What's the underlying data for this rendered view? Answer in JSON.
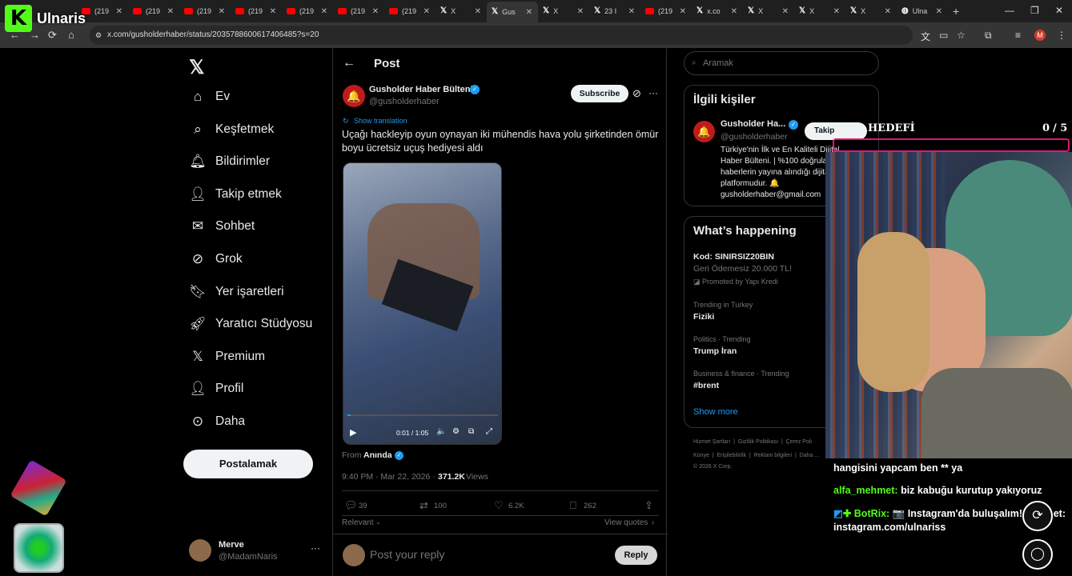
{
  "browser": {
    "tabs": [
      {
        "label": "(219",
        "kind": "yt"
      },
      {
        "label": "(219",
        "kind": "yt"
      },
      {
        "label": "(219",
        "kind": "yt"
      },
      {
        "label": "(219",
        "kind": "yt"
      },
      {
        "label": "(219",
        "kind": "yt"
      },
      {
        "label": "(219",
        "kind": "yt"
      },
      {
        "label": "(219",
        "kind": "yt"
      },
      {
        "label": "X",
        "kind": "x"
      },
      {
        "label": "Gus",
        "kind": "x",
        "active": true
      },
      {
        "label": "X",
        "kind": "x"
      },
      {
        "label": "23 I",
        "kind": "x"
      },
      {
        "label": "(219",
        "kind": "yt"
      },
      {
        "label": "x.co",
        "kind": "x"
      },
      {
        "label": "X",
        "kind": "x"
      },
      {
        "label": "X",
        "kind": "x"
      },
      {
        "label": "X",
        "kind": "x"
      },
      {
        "label": "Ulna",
        "kind": "web"
      }
    ],
    "url": "x.com/gusholderhaber/status/2035788600617406485?s=20",
    "profile_initial": "M"
  },
  "overlay_logo": {
    "letter": "K",
    "name": "Ulnaris"
  },
  "sidebar": {
    "items": [
      {
        "label": "Ev",
        "icon": "home-icon"
      },
      {
        "label": "Keşfetmek",
        "icon": "search-icon"
      },
      {
        "label": "Bildirimler",
        "icon": "bell-icon"
      },
      {
        "label": "Takip etmek",
        "icon": "follow-icon"
      },
      {
        "label": "Sohbet",
        "icon": "mail-icon"
      },
      {
        "label": "Grok",
        "icon": "grok-icon"
      },
      {
        "label": "Yer işaretleri",
        "icon": "bookmark-icon"
      },
      {
        "label": "Yaratıcı Stüdyosu",
        "icon": "rocket-icon"
      },
      {
        "label": "Premium",
        "icon": "x-icon"
      },
      {
        "label": "Profil",
        "icon": "person-icon"
      },
      {
        "label": "Daha",
        "icon": "more-icon"
      }
    ],
    "post_button": "Postalamak",
    "account": {
      "name": "Merve",
      "handle": "@MadamNaris"
    }
  },
  "post": {
    "header": "Post",
    "author": "Gusholder Haber Bülteni",
    "handle": "@gusholderhaber",
    "subscribe": "Subscribe",
    "show_translation": "Show translation",
    "text": "Uçağı hackleyip oyun oynayan iki mühendis hava yolu şirketinden ömür boyu ücretsiz uçuş hediyesi aldı",
    "video_time": "0:01 / 1:05",
    "from_label": "From",
    "from_source": "Anında",
    "timestamp": "9:40 PM · Mar 22, 2026 ·",
    "views_count": "371.2K",
    "views_label": "Views",
    "replies": "39",
    "reposts": "100",
    "likes": "6.2K",
    "bookmarks": "262",
    "relevant": "Relevant",
    "view_quotes": "View quotes",
    "reply_placeholder": "Post your reply",
    "reply_button": "Reply",
    "video_progress": 0.02
  },
  "right": {
    "search_placeholder": "Aramak",
    "related_title": "İlgili kişiler",
    "related_name": "Gusholder Ha...",
    "related_handle": "@gusholderhaber",
    "follow_label": "Takip",
    "related_bio": "Türkiye'nin İlk ve En Kaliteli Dijital Haber Bülteni. | %100 doğrulanmış haberlerin yayına alındığı dijital platformudur. 🔔 gusholderhaber@gmail.com",
    "happening_title": "What’s happening",
    "trends": [
      {
        "meta": "",
        "title": "Kod: SINIRSIZ20BIN",
        "sub": "Geri Ödemesiz 20.000 TL!",
        "promo": "Promoted by Yapı Kredi"
      },
      {
        "meta": "Trending in Turkey",
        "title": "Fiziki"
      },
      {
        "meta": "Politics · Trending",
        "title": "Trump İran"
      },
      {
        "meta": "Business & finance · Trending",
        "title": "#brent"
      }
    ],
    "show_more": "Show more",
    "footer1": "Hizmet Şartları  |  Gizlilik Politikası  |  Çerez Poli",
    "footer2": "Künye  |  Erişilebilirlik  |  Reklam bilgileri  |  Daha ...",
    "footer3": "© 2026 X Corp."
  },
  "stream": {
    "goal_label": "HEDEFİ",
    "goal_count": "0",
    "goal_total": "/ 5",
    "chat": [
      {
        "user": "",
        "text": "hangisini yapcam ben ** ya"
      },
      {
        "user": "alfa_mehmet:",
        "text": "biz kabuğu kurutup yakıyoruz"
      },
      {
        "user": "BotRix:",
        "text": "📷 Instagram'da buluşalım! Takip et: instagram.com/ulnariss"
      }
    ]
  },
  "colors": {
    "accent": "#1d9bf0",
    "goal_bar": "#e0177a",
    "kick_green": "#53fc18"
  }
}
